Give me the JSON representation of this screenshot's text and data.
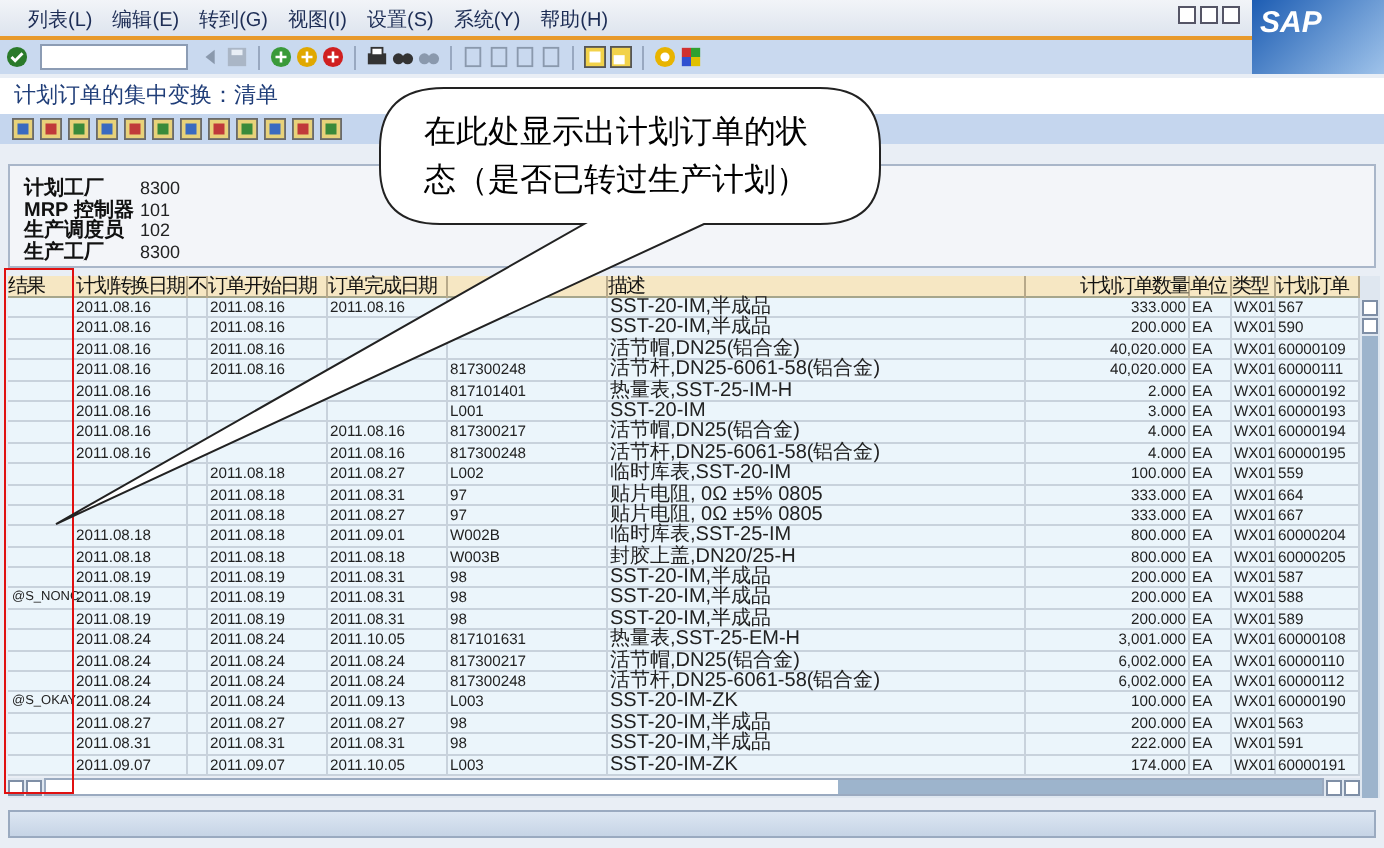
{
  "menu": [
    "列表(L)",
    "编辑(E)",
    "转到(G)",
    "视图(I)",
    "设置(S)",
    "系统(Y)",
    "帮助(H)"
  ],
  "logo": "SAP",
  "title": "计划订单的集中变换：清单",
  "header_fields": [
    {
      "label": "计划工厂",
      "value": "8300"
    },
    {
      "label": "MRP 控制器",
      "value": "101"
    },
    {
      "label": "生产调度员",
      "value": "102"
    },
    {
      "label": "生产工厂",
      "value": "8300"
    }
  ],
  "table": {
    "columns": [
      {
        "label": "结果"
      },
      {
        "label": "计划转换日期"
      },
      {
        "label": "不"
      },
      {
        "label": "订单开始日期"
      },
      {
        "label": "订单完成日期"
      },
      {},
      {
        "label": "描述"
      },
      {
        "label": "计划订单数量"
      },
      {
        "label": "单位"
      },
      {
        "label": "类型"
      },
      {
        "label": "计划订单"
      }
    ],
    "rows": [
      {
        "cells": [
          null,
          "2011.08.16",
          null,
          "2011.08.16",
          "2011.08.16",
          null,
          "SST-20-IM,半成品",
          "333.000",
          "EA",
          "WX01",
          "567"
        ]
      },
      {
        "cells": [
          null,
          "2011.08.16",
          null,
          "2011.08.16",
          null,
          null,
          "SST-20-IM,半成品",
          "200.000",
          "EA",
          "WX01",
          "590"
        ]
      },
      {
        "cells": [
          null,
          "2011.08.16",
          null,
          "2011.08.16",
          null,
          null,
          "活节帽,DN25(铝合金)",
          "40,020.000",
          "EA",
          "WX01",
          "60000109"
        ]
      },
      {
        "cells": [
          null,
          "2011.08.16",
          null,
          "2011.08.16",
          null,
          "817300248",
          "活节杆,DN25-6061-58(铝合金)",
          "40,020.000",
          "EA",
          "WX01",
          "60000111"
        ]
      },
      {
        "cells": [
          null,
          "2011.08.16",
          null,
          null,
          null,
          "817101401",
          "热量表,SST-25-IM-H",
          "2.000",
          "EA",
          "WX01",
          "60000192"
        ]
      },
      {
        "cells": [
          null,
          "2011.08.16",
          null,
          null,
          null,
          "L001",
          "SST-20-IM",
          "3.000",
          "EA",
          "WX01",
          "60000193"
        ]
      },
      {
        "cells": [
          null,
          "2011.08.16",
          null,
          null,
          "2011.08.16",
          "817300217",
          "活节帽,DN25(铝合金)",
          "4.000",
          "EA",
          "WX01",
          "60000194"
        ]
      },
      {
        "cells": [
          null,
          "2011.08.16",
          null,
          null,
          "2011.08.16",
          "817300248",
          "活节杆,DN25-6061-58(铝合金)",
          "4.000",
          "EA",
          "WX01",
          "60000195"
        ]
      },
      {
        "cells": [
          null,
          null,
          null,
          "2011.08.18",
          "2011.08.27",
          "L002",
          "临时库表,SST-20-IM",
          "100.000",
          "EA",
          "WX01",
          "559"
        ]
      },
      {
        "cells": [
          null,
          null,
          null,
          "2011.08.18",
          "2011.08.31",
          "97",
          "贴片电阻, 0Ω ±5% 0805",
          "333.000",
          "EA",
          "WX01",
          "664"
        ]
      },
      {
        "cells": [
          null,
          null,
          null,
          "2011.08.18",
          "2011.08.27",
          "97",
          "贴片电阻, 0Ω ±5% 0805",
          "333.000",
          "EA",
          "WX01",
          "667"
        ]
      },
      {
        "cells": [
          null,
          "2011.08.18",
          null,
          "2011.08.18",
          "2011.09.01",
          "W002B",
          "临时库表,SST-25-IM",
          "800.000",
          "EA",
          "WX01",
          "60000204"
        ]
      },
      {
        "cells": [
          null,
          "2011.08.18",
          null,
          "2011.08.18",
          "2011.08.18",
          "W003B",
          "封胶上盖,DN20/25-H",
          "800.000",
          "EA",
          "WX01",
          "60000205"
        ]
      },
      {
        "cells": [
          null,
          "2011.08.19",
          null,
          "2011.08.19",
          "2011.08.31",
          "98",
          "SST-20-IM,半成品",
          "200.000",
          "EA",
          "WX01",
          "587"
        ]
      },
      {
        "cells": [
          "@S_NONC",
          "2011.08.19",
          null,
          "2011.08.19",
          "2011.08.31",
          "98",
          "SST-20-IM,半成品",
          "200.000",
          "EA",
          "WX01",
          "588"
        ]
      },
      {
        "cells": [
          null,
          "2011.08.19",
          null,
          "2011.08.19",
          "2011.08.31",
          "98",
          "SST-20-IM,半成品",
          "200.000",
          "EA",
          "WX01",
          "589"
        ]
      },
      {
        "cells": [
          null,
          "2011.08.24",
          null,
          "2011.08.24",
          "2011.10.05",
          "817101631",
          "热量表,SST-25-EM-H",
          "3,001.000",
          "EA",
          "WX01",
          "60000108"
        ]
      },
      {
        "cells": [
          null,
          "2011.08.24",
          null,
          "2011.08.24",
          "2011.08.24",
          "817300217",
          "活节帽,DN25(铝合金)",
          "6,002.000",
          "EA",
          "WX01",
          "60000110"
        ]
      },
      {
        "cells": [
          null,
          "2011.08.24",
          null,
          "2011.08.24",
          "2011.08.24",
          "817300248",
          "活节杆,DN25-6061-58(铝合金)",
          "6,002.000",
          "EA",
          "WX01",
          "60000112"
        ]
      },
      {
        "cells": [
          "@S_OKAY",
          "2011.08.24",
          null,
          "2011.08.24",
          "2011.09.13",
          "L003",
          "SST-20-IM-ZK",
          "100.000",
          "EA",
          "WX01",
          "60000190"
        ]
      },
      {
        "cells": [
          null,
          "2011.08.27",
          null,
          "2011.08.27",
          "2011.08.27",
          "98",
          "SST-20-IM,半成品",
          "200.000",
          "EA",
          "WX01",
          "563"
        ]
      },
      {
        "cells": [
          null,
          "2011.08.31",
          null,
          "2011.08.31",
          "2011.08.31",
          "98",
          "SST-20-IM,半成品",
          "222.000",
          "EA",
          "WX01",
          "591"
        ]
      },
      {
        "cells": [
          null,
          "2011.09.07",
          null,
          "2011.09.07",
          "2011.10.05",
          "L003",
          "SST-20-IM-ZK",
          "174.000",
          "EA",
          "WX01",
          "60000191"
        ]
      }
    ]
  },
  "callout": {
    "text": "在此处显示出计划订单的状态（是否已转过生产计划）"
  }
}
